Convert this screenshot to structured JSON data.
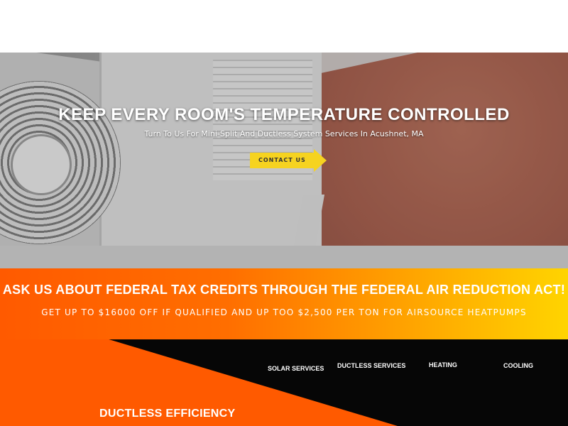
{
  "hero": {
    "title": "KEEP EVERY ROOM'S TEMPERATURE CONTROLLED",
    "subtitle": "Turn To Us For Mini-Split And Ductless System Services In Acushnet, MA",
    "cta_label": "CONTACT US",
    "image_icon": "air-conditioner-unit-photo"
  },
  "promo": {
    "title": "ASK US ABOUT FEDERAL TAX CREDITS THROUGH THE FEDERAL AIR REDUCTION ACT!",
    "subtitle": "GET UP TO $16000 OFF IF QUALIFIED AND UP TOO $2,500 PER TON FOR AIRSOURCE HEATPUMPS"
  },
  "services_nav": {
    "items": [
      {
        "label": "SOLAR SERVICES"
      },
      {
        "label": "DUCTLESS SERVICES"
      },
      {
        "label": "HEATING"
      },
      {
        "label": "COOLING"
      }
    ]
  },
  "section": {
    "title": "DUCTLESS EFFICIENCY"
  },
  "colors": {
    "accent_orange": "#ff5a00",
    "accent_yellow": "#f6d320",
    "dark_band": "#060606"
  }
}
